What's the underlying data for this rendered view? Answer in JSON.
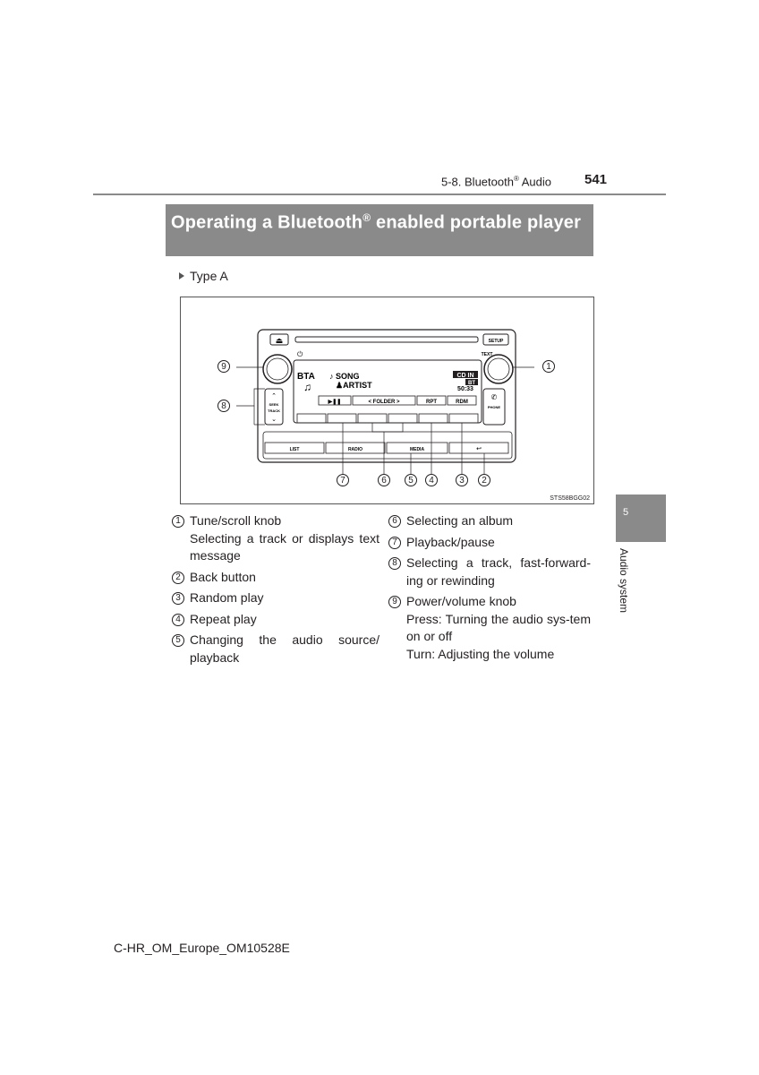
{
  "header": {
    "section": "5-8. Bluetooth",
    "section_reg": "®",
    "section_suffix": " Audio",
    "page_number": "541"
  },
  "title": {
    "line1_a": "Operating a Bluetooth",
    "reg": "®",
    "line1_b": " enabled portable player"
  },
  "type_label": "Type A",
  "figure": {
    "code": "STS58BGG02",
    "device": {
      "eject_icon": "⏏",
      "setup": "SETUP",
      "text": "TEXT",
      "power_icon": "⏻",
      "display_source": "BTA",
      "display_song": "♪ SONG",
      "display_artist": "♟ARTIST",
      "display_cdin": "CD IN",
      "display_bt": "BT",
      "display_time": "50:33",
      "soft_keys": [
        "▶❚❚",
        "<  FOLDER  >",
        "RPT",
        "RDM"
      ],
      "seek": "SEEK",
      "track": "TRACK",
      "phone": "PHONE",
      "bottom_buttons": [
        "LIST",
        "RADIO",
        "MEDIA",
        "↩"
      ]
    },
    "callouts": [
      "1",
      "2",
      "3",
      "4",
      "5",
      "6",
      "7",
      "8",
      "9"
    ]
  },
  "legend_left": [
    {
      "num": "1",
      "lines": [
        "Tune/scroll knob",
        "Selecting a track or displays text message"
      ]
    },
    {
      "num": "2",
      "lines": [
        "Back button"
      ]
    },
    {
      "num": "3",
      "lines": [
        "Random play"
      ]
    },
    {
      "num": "4",
      "lines": [
        "Repeat play"
      ]
    },
    {
      "num": "5",
      "lines": [
        "Changing the audio source/ playback"
      ]
    }
  ],
  "legend_right": [
    {
      "num": "6",
      "lines": [
        "Selecting an album"
      ]
    },
    {
      "num": "7",
      "lines": [
        "Playback/pause"
      ]
    },
    {
      "num": "8",
      "lines": [
        "Selecting a track, fast-forward-ing or rewinding"
      ]
    },
    {
      "num": "9",
      "lines": [
        "Power/volume knob",
        "Press: Turning the audio sys-tem on or off",
        "Turn: Adjusting the volume"
      ]
    }
  ],
  "side_tab": {
    "number": "5",
    "label": "Audio system"
  },
  "footer": "C-HR_OM_Europe_OM10528E"
}
